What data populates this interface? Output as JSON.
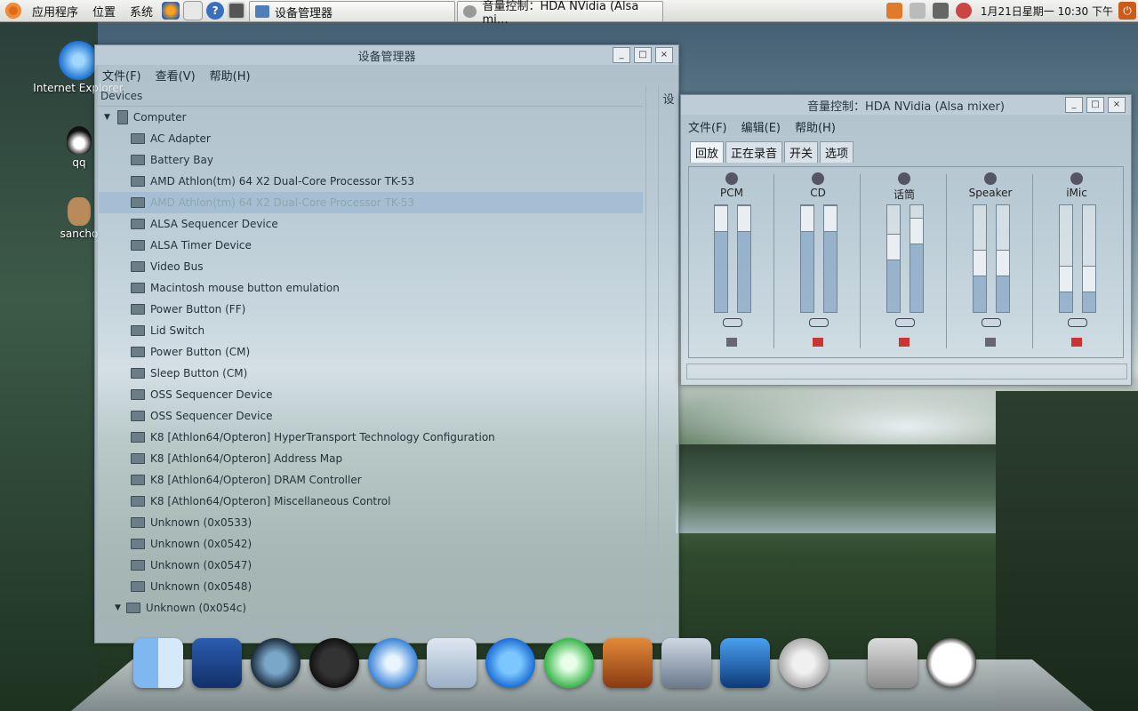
{
  "top_panel": {
    "menus": [
      "应用程序",
      "位置",
      "系统"
    ],
    "tasks": [
      {
        "label": "设备管理器"
      },
      {
        "label": "音量控制：HDA NVidia (Alsa mi…"
      }
    ],
    "clock": "1月21日星期一 10:30 下午"
  },
  "desktop_icons": [
    {
      "label": "Internet Explorer"
    },
    {
      "label": "qq"
    },
    {
      "label": "sancho"
    }
  ],
  "device_manager": {
    "title": "设备管理器",
    "menus": [
      "文件(F)",
      "查看(V)",
      "帮助(H)"
    ],
    "tree_header": "Devices",
    "right_pane_char": "设",
    "root": "Computer",
    "items": [
      "AC Adapter",
      "Battery Bay",
      "AMD Athlon(tm) 64 X2 Dual-Core Processor TK-53",
      "AMD Athlon(tm) 64 X2 Dual-Core Processor TK-53",
      "ALSA Sequencer Device",
      "ALSA Timer Device",
      "Video Bus",
      "Macintosh mouse button emulation",
      "Power Button (FF)",
      "Lid Switch",
      "Power Button (CM)",
      "Sleep Button (CM)",
      "OSS Sequencer Device",
      "OSS Sequencer Device",
      "K8 [Athlon64/Opteron] HyperTransport Technology Configuration",
      "K8 [Athlon64/Opteron] Address Map",
      "K8 [Athlon64/Opteron] DRAM Controller",
      "K8 [Athlon64/Opteron] Miscellaneous Control",
      "Unknown (0x0533)",
      "Unknown (0x0542)",
      "Unknown (0x0547)",
      "Unknown (0x0548)",
      "Unknown (0x054c)"
    ],
    "selected_index": 3
  },
  "mixer": {
    "title": "音量控制：HDA NVidia (Alsa mixer)",
    "menus": [
      "文件(F)",
      "编辑(E)",
      "帮助(H)"
    ],
    "tabs": [
      "回放",
      "正在录音",
      "开关",
      "选项"
    ],
    "active_tab": 0,
    "channels": [
      {
        "name": "PCM",
        "icon": "music-note-icon",
        "levels": [
          0.9,
          0.9
        ],
        "muted": false
      },
      {
        "name": "CD",
        "icon": "disc-icon",
        "levels": [
          0.8,
          0.8
        ],
        "muted": true
      },
      {
        "name": "话筒",
        "icon": "microphone-icon",
        "levels": [
          0.5,
          0.65
        ],
        "muted": true
      },
      {
        "name": "Speaker",
        "icon": "speaker-icon",
        "levels": [
          0.35,
          0.35
        ],
        "muted": false
      },
      {
        "name": "iMic",
        "icon": "microphone-icon",
        "levels": [
          0.2,
          0.2
        ],
        "muted": true
      }
    ]
  },
  "dock": {
    "items": [
      "finder-icon",
      "spaces-icon",
      "time-machine-icon",
      "dashboard-icon",
      "safari-icon",
      "mail-stamp-icon",
      "ichat-icon",
      "itunes-icon",
      "photo-booth-icon",
      "iphoto-icon",
      "imovie-icon",
      "mail-at-icon",
      "trash-icon",
      "clock-icon"
    ]
  }
}
